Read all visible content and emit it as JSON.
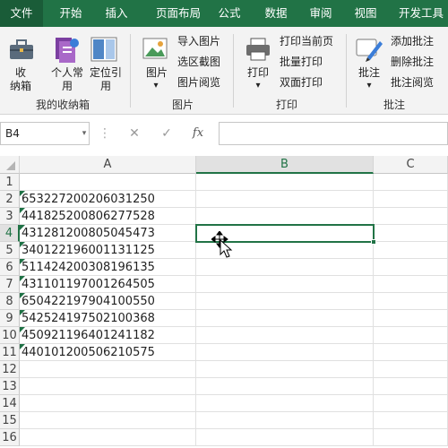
{
  "tabs": [
    "文件",
    "开始",
    "插入",
    "页面布局",
    "公式",
    "数据",
    "审阅",
    "视图",
    "开发工具"
  ],
  "ribbon": {
    "my_toolbox": {
      "group": "我的收纳箱",
      "toolbox": "收\n纳箱",
      "personal": "个人常\n用",
      "locate": "定位引\n用"
    },
    "picture": {
      "group": "图片",
      "picture_btn": "图片",
      "import": "导入图片",
      "region": "选区截图",
      "browse": "图片阅览"
    },
    "print": {
      "group": "打印",
      "print_btn": "打印",
      "current_page": "打印当前页",
      "batch": "批量打印",
      "duplex": "双面打印"
    },
    "comment": {
      "group": "批注",
      "comment_btn": "批注",
      "add": "添加批注",
      "delete": "删除批注",
      "read": "批注阅览"
    }
  },
  "formula_bar": {
    "name_box": "B4",
    "cancel": "✕",
    "confirm": "✓",
    "fx": "fx",
    "value": ""
  },
  "columns": [
    "A",
    "B",
    "C"
  ],
  "selected_column": "B",
  "selected_row": 4,
  "rows": [
    {
      "n": "1",
      "a": ""
    },
    {
      "n": "2",
      "a": "653227200206031250"
    },
    {
      "n": "3",
      "a": "441825200806277528"
    },
    {
      "n": "4",
      "a": "431281200805045473"
    },
    {
      "n": "5",
      "a": "340122196001131125"
    },
    {
      "n": "6",
      "a": "511424200308196135"
    },
    {
      "n": "7",
      "a": "431101197001264505"
    },
    {
      "n": "8",
      "a": "650422197904100550"
    },
    {
      "n": "9",
      "a": "542524197502100368"
    },
    {
      "n": "10",
      "a": "450921196401241182"
    },
    {
      "n": "11",
      "a": "440101200506210575"
    },
    {
      "n": "12",
      "a": ""
    },
    {
      "n": "13",
      "a": ""
    },
    {
      "n": "14",
      "a": ""
    },
    {
      "n": "15",
      "a": ""
    },
    {
      "n": "16",
      "a": ""
    }
  ],
  "colors": {
    "accent": "#217346",
    "tab_bar": "#217346",
    "marker": "#1e7145"
  }
}
